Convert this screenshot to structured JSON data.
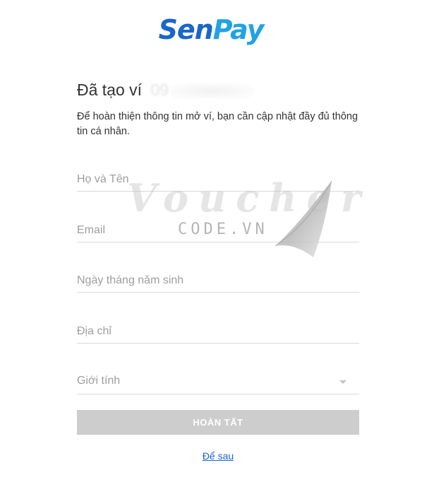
{
  "logo": {
    "part1": "Sen",
    "part2": "Pay"
  },
  "heading": {
    "title": "Đã tạo ví",
    "masked_number": "09"
  },
  "description": "Để hoàn thiện thông tin mở ví, bạn cần cập nhật đầy đủ thông tin cá nhân.",
  "form": {
    "full_name_placeholder": "Họ và Tên",
    "email_placeholder": "Email",
    "birthdate_placeholder": "Ngày tháng năm sinh",
    "address_placeholder": "Địa chỉ",
    "gender_label": "Giới tính"
  },
  "actions": {
    "submit_label": "HOÀN TẤT",
    "later_label": "Để sau"
  },
  "watermark": {
    "script": "Voucher",
    "code": "CODE.VN"
  },
  "colors": {
    "brand_dark_blue": "#1a66cc",
    "brand_light_blue": "#1fa3e6",
    "button_disabled": "#cdcdcd"
  },
  "icons": {
    "gender_dropdown": "caret-down-icon"
  }
}
